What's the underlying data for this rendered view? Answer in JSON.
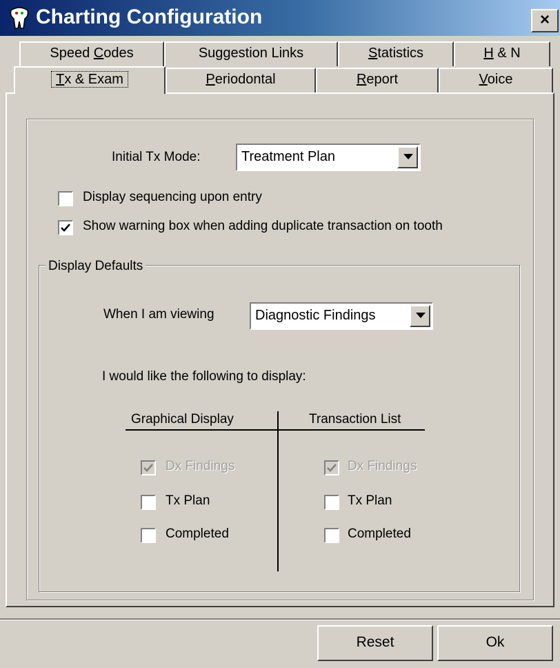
{
  "window": {
    "title": "Charting Configuration",
    "close_label": "×"
  },
  "tabs": {
    "row_back": [
      {
        "label": "Speed Codes",
        "underline": "C",
        "before": "Speed ",
        "after": "odes"
      },
      {
        "label": "Suggestion Links"
      },
      {
        "label": "Statistics",
        "underline": "S",
        "before": "",
        "after": "tatistics"
      },
      {
        "label": "H & N",
        "underline": "H",
        "before": "",
        "after": " & N"
      }
    ],
    "row_front": [
      {
        "label": "Tx & Exam",
        "underline": "T",
        "before": "",
        "after": "x & Exam",
        "selected": true
      },
      {
        "label": "Periodontal",
        "underline": "P",
        "before": "",
        "after": "eriodontal"
      },
      {
        "label": "Report",
        "underline": "R",
        "before": "",
        "after": "eport"
      },
      {
        "label": "Voice",
        "underline": "V",
        "before": "",
        "after": "oice"
      }
    ]
  },
  "tx_exam": {
    "initial_mode_label": "Initial Tx Mode:",
    "initial_mode_value": "Treatment Plan",
    "display_sequencing": {
      "label": "Display sequencing upon entry",
      "checked": false
    },
    "show_warning": {
      "label": "Show warning box when adding duplicate transaction on tooth",
      "checked": true
    }
  },
  "display_defaults": {
    "group_label": "Display Defaults",
    "viewing_label": "When I am viewing",
    "viewing_value": "Diagnostic Findings",
    "instruction": "I would like the following to display:",
    "graphical": {
      "header": "Graphical Display",
      "items": [
        {
          "label": "Dx Findings",
          "checked": true,
          "disabled": true
        },
        {
          "label": "Tx Plan",
          "checked": false,
          "disabled": false
        },
        {
          "label": "Completed",
          "checked": false,
          "disabled": false
        }
      ]
    },
    "transaction": {
      "header": "Transaction List",
      "items": [
        {
          "label": "Dx Findings",
          "checked": true,
          "disabled": true
        },
        {
          "label": "Tx Plan",
          "checked": false,
          "disabled": false
        },
        {
          "label": "Completed",
          "checked": false,
          "disabled": false
        }
      ]
    }
  },
  "buttons": {
    "reset": "Reset",
    "ok": "Ok"
  },
  "colors": {
    "titlebar_start": "#0a246a",
    "titlebar_end": "#a6caf0",
    "face": "#d4d0c8"
  }
}
